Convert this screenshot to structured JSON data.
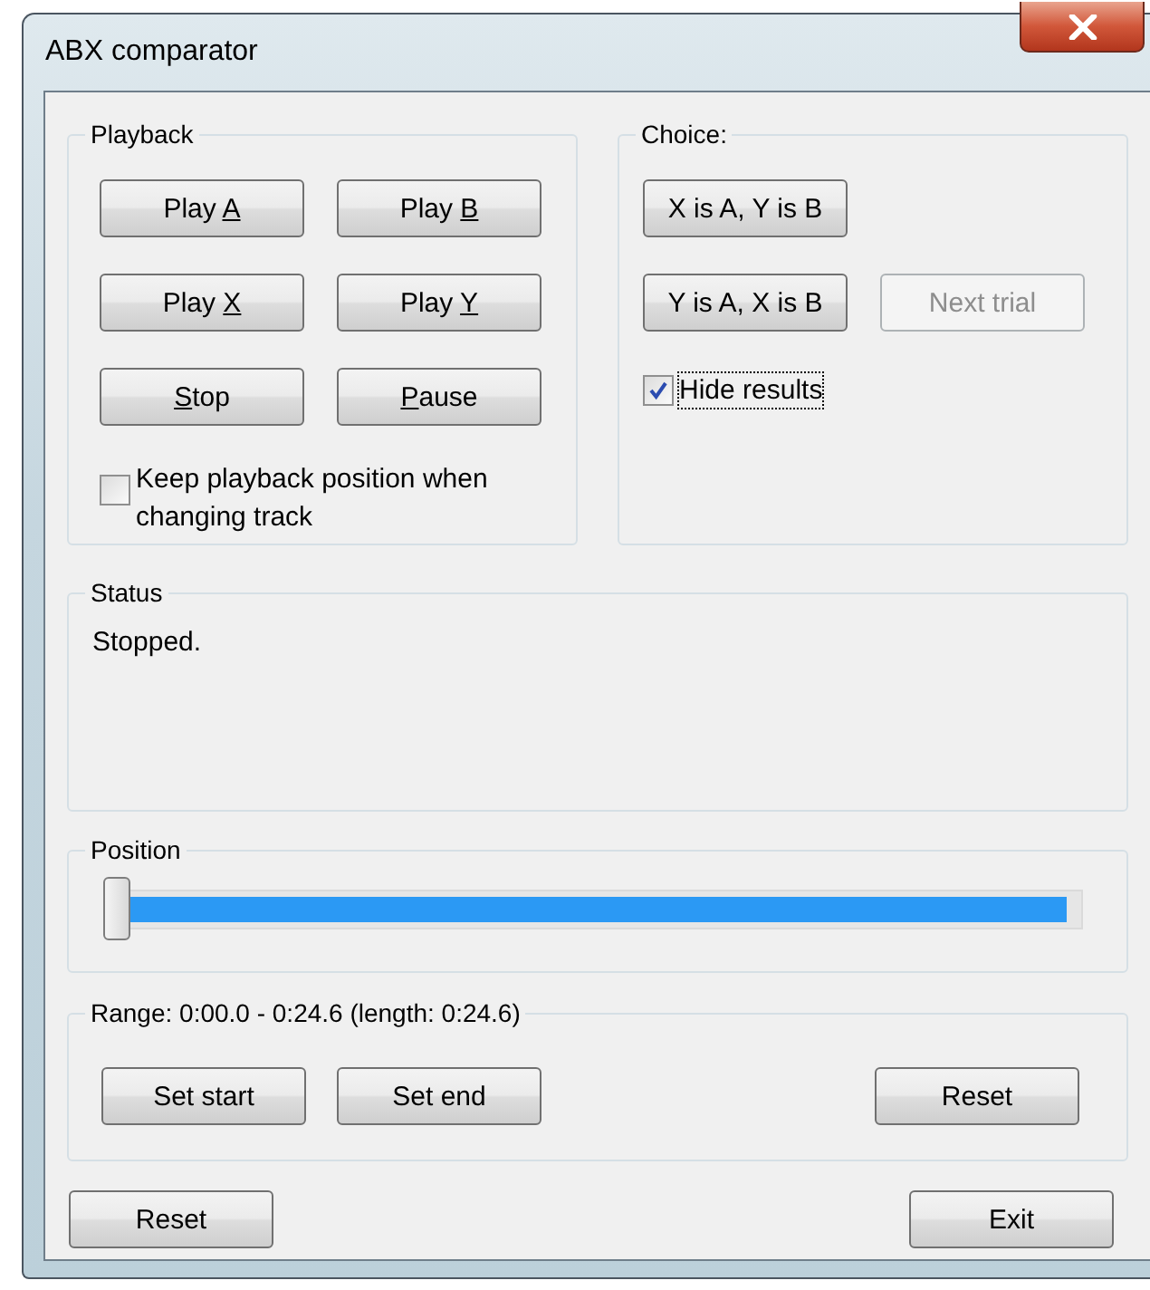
{
  "window": {
    "title": "ABX comparator"
  },
  "playback": {
    "title": "Playback",
    "buttons": [
      {
        "parts": [
          {
            "text": "Play ",
            "underlined": false
          },
          {
            "text": "A",
            "underlined": true
          }
        ]
      },
      {
        "parts": [
          {
            "text": "Play ",
            "underlined": false
          },
          {
            "text": "B",
            "underlined": true
          }
        ]
      },
      {
        "parts": [
          {
            "text": "Play ",
            "underlined": false
          },
          {
            "text": "X",
            "underlined": true
          }
        ]
      },
      {
        "parts": [
          {
            "text": "Play ",
            "underlined": false
          },
          {
            "text": "Y",
            "underlined": true
          }
        ]
      },
      {
        "parts": [
          {
            "text": "S",
            "underlined": true
          },
          {
            "text": "top",
            "underlined": false
          }
        ]
      },
      {
        "parts": [
          {
            "text": "P",
            "underlined": true
          },
          {
            "text": "ause",
            "underlined": false
          }
        ]
      }
    ],
    "checkbox": {
      "label": "Keep playback position when changing track",
      "checked": false,
      "focused": false
    }
  },
  "choice": {
    "title": "Choice:",
    "buttons": [
      {
        "parts": [
          {
            "text": "X is A, Y is B",
            "underlined": false
          }
        ],
        "disabled": false
      },
      {
        "parts": [
          {
            "text": "Y is A, X is B",
            "underlined": false
          }
        ],
        "disabled": false
      },
      {
        "parts": [
          {
            "text": "Next trial",
            "underlined": false
          }
        ],
        "disabled": true
      }
    ],
    "checkbox": {
      "label": "Hide results",
      "checked": true,
      "focused": true
    }
  },
  "status": {
    "title": "Status",
    "text": "Stopped."
  },
  "position": {
    "title": "Position",
    "slider": {
      "level": 0
    }
  },
  "range": {
    "title": "Range: 0:00.0 - 0:24.6 (length: 0:24.6)",
    "buttons": [
      {
        "parts": [
          {
            "text": "Set start",
            "underlined": false
          }
        ]
      },
      {
        "parts": [
          {
            "text": "Set end",
            "underlined": false
          }
        ]
      },
      {
        "parts": [
          {
            "text": "Reset",
            "underlined": false
          }
        ]
      }
    ]
  },
  "footer": {
    "buttons": [
      {
        "parts": [
          {
            "text": "Reset",
            "underlined": false
          }
        ]
      },
      {
        "parts": [
          {
            "text": "Exit",
            "underlined": false
          }
        ]
      }
    ]
  }
}
